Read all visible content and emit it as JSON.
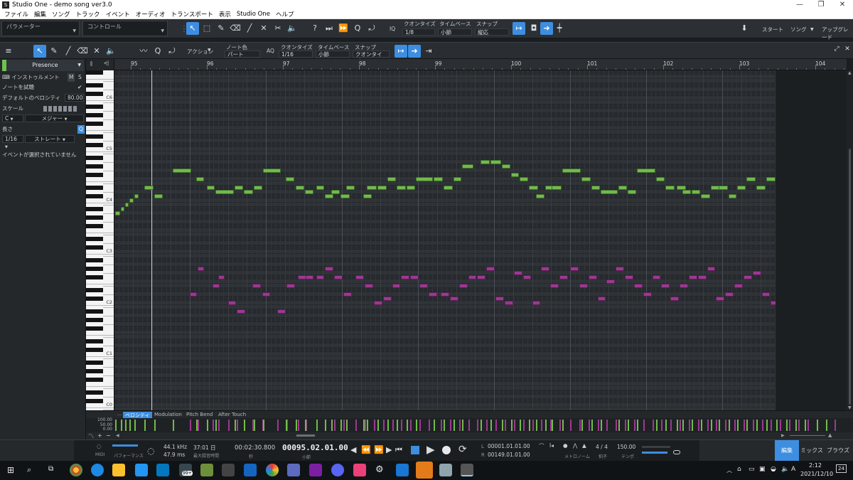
{
  "window": {
    "title": "Studio One - demo song ver3.0",
    "controls": [
      "minimize-icon",
      "maximize-icon",
      "close-icon"
    ]
  },
  "menu": [
    "ファイル",
    "編集",
    "ソング",
    "トラック",
    "イベント",
    "オーディオ",
    "トランスポート",
    "表示",
    "Studio One",
    "ヘルプ"
  ],
  "main_toolbar": {
    "parameter_label": "パラメーター",
    "control_label": "コントロール",
    "quantize_label": "クオンタイズ",
    "quantize_value": "1/8",
    "timebase_label": "タイムベース",
    "timebase_value": "小節",
    "snap_label": "スナップ",
    "snap_value": "縦応",
    "iq_label": "IQ",
    "start_label": "スタート",
    "song_label": "ソング",
    "upgrade_label": "アップグレード"
  },
  "editor_toolbar": {
    "action_label": "アクション",
    "note_color_label": "ノート色",
    "note_color_value": "パート",
    "aq_label": "AQ",
    "quantize_label": "クオンタイズ",
    "quantize_value": "1/16",
    "timebase_label": "タイムベース",
    "timebase_value": "小節",
    "snap_label": "スナップ",
    "snap_value": "クオンタイズ"
  },
  "inspector": {
    "preset": "Presence",
    "instrument_label": "インストゥルメント",
    "m_label": "M",
    "s_label": "S",
    "audition_label": "ノートを試聴",
    "default_velocity_label": "デフォルトのベロシティ",
    "default_velocity_value": "80.00",
    "scale_label": "スケール",
    "scale_root": "C",
    "scale_type": "メジャー",
    "length_label": "長さ",
    "length_value": "1/16",
    "length_mode": "ストレート",
    "no_event": "イベントが選択されていません"
  },
  "piano": {
    "octave_labels": [
      "C6",
      "C5",
      "C4",
      "C3",
      "C2",
      "C1",
      "C0"
    ]
  },
  "ruler": {
    "bars": [
      "95",
      "96",
      "97",
      "98",
      "99",
      "100",
      "101",
      "102",
      "103",
      "104"
    ]
  },
  "lanes": {
    "tabs": [
      "ベロシティ",
      "Modulation",
      "Pitch Bend",
      "After Touch"
    ],
    "scale": [
      "100.00",
      "50.00",
      "0.00"
    ]
  },
  "transport": {
    "midi_label": "MIDI",
    "performance_label": "パフォーマンス",
    "sample_rate": "44.1 kHz",
    "latency": "47.9 ms",
    "record_time": "37:01 日",
    "record_time_label": "最大録音時間",
    "time": "00:02:30.800",
    "time_unit": "秒",
    "position": "00095.02.01.00",
    "position_unit": "小節",
    "loop_l_label": "L",
    "loop_l": "00001.01.01.00",
    "loop_r_label": "R",
    "loop_r": "00149.01.01.00",
    "metronome_label": "メトロノーム",
    "signature": "4 / 4",
    "signature_label": "拍子",
    "tempo": "150.00",
    "tempo_label": "テンポ",
    "page_edit": "編集",
    "page_mix": "ミックス",
    "page_browse": "ブラウズ"
  },
  "taskbar": {
    "badge": "99+",
    "time": "2:12",
    "date": "2021/12/10",
    "notification_count": "24",
    "ime": "A"
  },
  "colors": {
    "accent": "#3d8ee0",
    "note_green": "#73b94d",
    "note_magenta": "#9a3a90"
  },
  "notes_green": [
    [
      95.02,
      95.09,
      45
    ],
    [
      95.09,
      95.15,
      46
    ],
    [
      95.15,
      95.21,
      47
    ],
    [
      95.21,
      95.27,
      48
    ],
    [
      95.27,
      95.34,
      49
    ],
    [
      95.4,
      95.53,
      51
    ],
    [
      95.53,
      95.65,
      49
    ],
    [
      95.78,
      96.03,
      55
    ],
    [
      96.08,
      96.2,
      53
    ],
    [
      96.22,
      96.34,
      51
    ],
    [
      96.34,
      96.59,
      50
    ],
    [
      96.59,
      96.71,
      51
    ],
    [
      96.71,
      96.84,
      50
    ],
    [
      96.84,
      96.96,
      51
    ],
    [
      96.96,
      97.21,
      55
    ],
    [
      97.26,
      97.38,
      53
    ],
    [
      97.39,
      97.51,
      51
    ],
    [
      97.51,
      97.64,
      50
    ],
    [
      97.66,
      97.78,
      51
    ],
    [
      97.78,
      97.9,
      49
    ],
    [
      97.86,
      97.98,
      50
    ],
    [
      97.98,
      98.11,
      49
    ],
    [
      98.06,
      98.18,
      51
    ],
    [
      98.28,
      98.4,
      49
    ],
    [
      98.33,
      98.47,
      51
    ],
    [
      98.47,
      98.6,
      51
    ],
    [
      98.6,
      98.72,
      53
    ],
    [
      98.72,
      98.85,
      51
    ],
    [
      98.85,
      98.97,
      51
    ],
    [
      98.97,
      99.21,
      53
    ],
    [
      99.21,
      99.34,
      53
    ],
    [
      99.34,
      99.47,
      51
    ],
    [
      99.47,
      99.58,
      53
    ],
    [
      99.58,
      99.74,
      56
    ],
    [
      99.82,
      99.95,
      57
    ],
    [
      99.95,
      100.1,
      57
    ],
    [
      100.1,
      100.22,
      56
    ],
    [
      100.22,
      100.34,
      54
    ],
    [
      100.34,
      100.46,
      53
    ],
    [
      100.46,
      100.59,
      51
    ],
    [
      100.55,
      100.67,
      49
    ],
    [
      100.67,
      100.79,
      51
    ],
    [
      100.76,
      100.9,
      51
    ],
    [
      100.9,
      101.15,
      55
    ],
    [
      101.15,
      101.28,
      53
    ],
    [
      101.28,
      101.4,
      51
    ],
    [
      101.4,
      101.64,
      50
    ],
    [
      101.64,
      101.76,
      51
    ],
    [
      101.76,
      101.88,
      50
    ],
    [
      101.88,
      102.13,
      55
    ],
    [
      102.13,
      102.25,
      53
    ],
    [
      102.25,
      102.38,
      51
    ],
    [
      102.4,
      102.53,
      51
    ],
    [
      102.48,
      102.6,
      50
    ],
    [
      102.6,
      102.72,
      50
    ],
    [
      102.72,
      102.85,
      49
    ],
    [
      102.85,
      102.98,
      51
    ],
    [
      102.95,
      103.08,
      51
    ],
    [
      103.08,
      103.2,
      49
    ],
    [
      103.2,
      103.32,
      51
    ],
    [
      103.32,
      103.45,
      53
    ],
    [
      103.45,
      103.58,
      51
    ],
    [
      103.58,
      103.71,
      53
    ],
    [
      103.71,
      103.84,
      53
    ],
    [
      103.84,
      103.96,
      51
    ],
    [
      103.96,
      104.08,
      53
    ],
    [
      104.08,
      104.34,
      56
    ],
    [
      104.24,
      104.36,
      55
    ],
    [
      104.36,
      104.6,
      56
    ]
  ],
  "notes_magenta": [
    [
      96.0,
      96.1,
      26
    ],
    [
      96.1,
      96.2,
      32
    ],
    [
      96.3,
      96.4,
      28
    ],
    [
      96.37,
      96.47,
      30
    ],
    [
      96.5,
      96.62,
      24
    ],
    [
      96.62,
      96.74,
      22
    ],
    [
      96.82,
      96.94,
      28
    ],
    [
      96.95,
      97.07,
      26
    ],
    [
      97.15,
      97.27,
      22
    ],
    [
      97.27,
      97.39,
      28
    ],
    [
      97.42,
      97.54,
      30
    ],
    [
      97.52,
      97.64,
      30
    ],
    [
      97.66,
      97.78,
      30
    ],
    [
      97.78,
      97.9,
      32
    ],
    [
      97.9,
      98.02,
      30
    ],
    [
      98.02,
      98.14,
      26
    ],
    [
      98.18,
      98.3,
      30
    ],
    [
      98.3,
      98.42,
      28
    ],
    [
      98.42,
      98.54,
      24
    ],
    [
      98.54,
      98.66,
      25
    ],
    [
      98.66,
      98.78,
      28
    ],
    [
      98.78,
      98.9,
      30
    ],
    [
      98.9,
      99.02,
      30
    ],
    [
      99.02,
      99.14,
      28
    ],
    [
      99.14,
      99.26,
      26
    ],
    [
      99.3,
      99.42,
      26
    ],
    [
      99.42,
      99.54,
      25
    ],
    [
      99.54,
      99.66,
      28
    ],
    [
      99.66,
      99.78,
      30
    ],
    [
      99.78,
      99.9,
      30
    ],
    [
      99.9,
      100.02,
      32
    ],
    [
      100.02,
      100.14,
      25
    ],
    [
      100.14,
      100.26,
      24
    ],
    [
      100.26,
      100.38,
      31
    ],
    [
      100.38,
      100.5,
      30
    ],
    [
      100.5,
      100.62,
      24
    ],
    [
      100.62,
      100.74,
      32
    ],
    [
      100.74,
      100.86,
      28
    ],
    [
      100.86,
      100.98,
      30
    ],
    [
      101.0,
      101.12,
      32
    ],
    [
      101.12,
      101.24,
      28
    ],
    [
      101.24,
      101.36,
      30
    ],
    [
      101.36,
      101.48,
      25
    ],
    [
      101.48,
      101.6,
      29
    ],
    [
      101.6,
      101.72,
      32
    ],
    [
      101.72,
      101.84,
      30
    ],
    [
      101.84,
      101.96,
      28
    ],
    [
      101.96,
      102.08,
      26
    ],
    [
      102.08,
      102.2,
      30
    ],
    [
      102.2,
      102.32,
      28
    ],
    [
      102.32,
      102.44,
      25
    ],
    [
      102.44,
      102.56,
      28
    ],
    [
      102.56,
      102.68,
      30
    ],
    [
      102.68,
      102.8,
      30
    ],
    [
      102.8,
      102.92,
      32
    ],
    [
      102.92,
      103.04,
      25
    ],
    [
      103.04,
      103.16,
      26
    ],
    [
      103.16,
      103.28,
      28
    ],
    [
      103.28,
      103.4,
      30
    ],
    [
      103.4,
      103.52,
      31
    ],
    [
      103.52,
      103.64,
      26
    ],
    [
      103.64,
      103.76,
      24
    ],
    [
      103.76,
      103.88,
      28
    ],
    [
      103.88,
      104.0,
      30
    ],
    [
      104.0,
      104.12,
      26
    ],
    [
      104.12,
      104.24,
      32
    ],
    [
      104.24,
      104.36,
      30
    ],
    [
      104.36,
      104.48,
      26
    ],
    [
      104.48,
      104.6,
      32
    ]
  ]
}
